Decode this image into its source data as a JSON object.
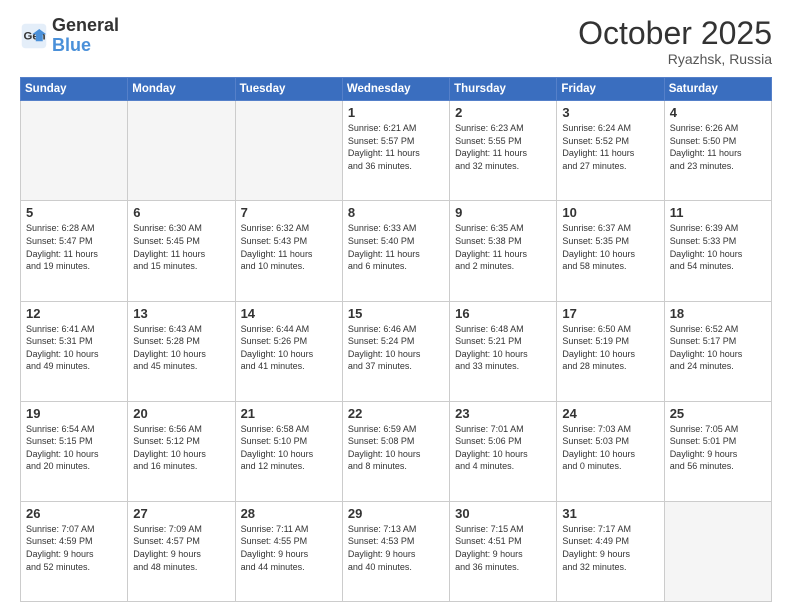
{
  "header": {
    "logo_line1": "General",
    "logo_line2": "Blue",
    "month": "October 2025",
    "location": "Ryazhsk, Russia"
  },
  "weekdays": [
    "Sunday",
    "Monday",
    "Tuesday",
    "Wednesday",
    "Thursday",
    "Friday",
    "Saturday"
  ],
  "weeks": [
    [
      {
        "day": "",
        "info": ""
      },
      {
        "day": "",
        "info": ""
      },
      {
        "day": "",
        "info": ""
      },
      {
        "day": "1",
        "info": "Sunrise: 6:21 AM\nSunset: 5:57 PM\nDaylight: 11 hours\nand 36 minutes."
      },
      {
        "day": "2",
        "info": "Sunrise: 6:23 AM\nSunset: 5:55 PM\nDaylight: 11 hours\nand 32 minutes."
      },
      {
        "day": "3",
        "info": "Sunrise: 6:24 AM\nSunset: 5:52 PM\nDaylight: 11 hours\nand 27 minutes."
      },
      {
        "day": "4",
        "info": "Sunrise: 6:26 AM\nSunset: 5:50 PM\nDaylight: 11 hours\nand 23 minutes."
      }
    ],
    [
      {
        "day": "5",
        "info": "Sunrise: 6:28 AM\nSunset: 5:47 PM\nDaylight: 11 hours\nand 19 minutes."
      },
      {
        "day": "6",
        "info": "Sunrise: 6:30 AM\nSunset: 5:45 PM\nDaylight: 11 hours\nand 15 minutes."
      },
      {
        "day": "7",
        "info": "Sunrise: 6:32 AM\nSunset: 5:43 PM\nDaylight: 11 hours\nand 10 minutes."
      },
      {
        "day": "8",
        "info": "Sunrise: 6:33 AM\nSunset: 5:40 PM\nDaylight: 11 hours\nand 6 minutes."
      },
      {
        "day": "9",
        "info": "Sunrise: 6:35 AM\nSunset: 5:38 PM\nDaylight: 11 hours\nand 2 minutes."
      },
      {
        "day": "10",
        "info": "Sunrise: 6:37 AM\nSunset: 5:35 PM\nDaylight: 10 hours\nand 58 minutes."
      },
      {
        "day": "11",
        "info": "Sunrise: 6:39 AM\nSunset: 5:33 PM\nDaylight: 10 hours\nand 54 minutes."
      }
    ],
    [
      {
        "day": "12",
        "info": "Sunrise: 6:41 AM\nSunset: 5:31 PM\nDaylight: 10 hours\nand 49 minutes."
      },
      {
        "day": "13",
        "info": "Sunrise: 6:43 AM\nSunset: 5:28 PM\nDaylight: 10 hours\nand 45 minutes."
      },
      {
        "day": "14",
        "info": "Sunrise: 6:44 AM\nSunset: 5:26 PM\nDaylight: 10 hours\nand 41 minutes."
      },
      {
        "day": "15",
        "info": "Sunrise: 6:46 AM\nSunset: 5:24 PM\nDaylight: 10 hours\nand 37 minutes."
      },
      {
        "day": "16",
        "info": "Sunrise: 6:48 AM\nSunset: 5:21 PM\nDaylight: 10 hours\nand 33 minutes."
      },
      {
        "day": "17",
        "info": "Sunrise: 6:50 AM\nSunset: 5:19 PM\nDaylight: 10 hours\nand 28 minutes."
      },
      {
        "day": "18",
        "info": "Sunrise: 6:52 AM\nSunset: 5:17 PM\nDaylight: 10 hours\nand 24 minutes."
      }
    ],
    [
      {
        "day": "19",
        "info": "Sunrise: 6:54 AM\nSunset: 5:15 PM\nDaylight: 10 hours\nand 20 minutes."
      },
      {
        "day": "20",
        "info": "Sunrise: 6:56 AM\nSunset: 5:12 PM\nDaylight: 10 hours\nand 16 minutes."
      },
      {
        "day": "21",
        "info": "Sunrise: 6:58 AM\nSunset: 5:10 PM\nDaylight: 10 hours\nand 12 minutes."
      },
      {
        "day": "22",
        "info": "Sunrise: 6:59 AM\nSunset: 5:08 PM\nDaylight: 10 hours\nand 8 minutes."
      },
      {
        "day": "23",
        "info": "Sunrise: 7:01 AM\nSunset: 5:06 PM\nDaylight: 10 hours\nand 4 minutes."
      },
      {
        "day": "24",
        "info": "Sunrise: 7:03 AM\nSunset: 5:03 PM\nDaylight: 10 hours\nand 0 minutes."
      },
      {
        "day": "25",
        "info": "Sunrise: 7:05 AM\nSunset: 5:01 PM\nDaylight: 9 hours\nand 56 minutes."
      }
    ],
    [
      {
        "day": "26",
        "info": "Sunrise: 7:07 AM\nSunset: 4:59 PM\nDaylight: 9 hours\nand 52 minutes."
      },
      {
        "day": "27",
        "info": "Sunrise: 7:09 AM\nSunset: 4:57 PM\nDaylight: 9 hours\nand 48 minutes."
      },
      {
        "day": "28",
        "info": "Sunrise: 7:11 AM\nSunset: 4:55 PM\nDaylight: 9 hours\nand 44 minutes."
      },
      {
        "day": "29",
        "info": "Sunrise: 7:13 AM\nSunset: 4:53 PM\nDaylight: 9 hours\nand 40 minutes."
      },
      {
        "day": "30",
        "info": "Sunrise: 7:15 AM\nSunset: 4:51 PM\nDaylight: 9 hours\nand 36 minutes."
      },
      {
        "day": "31",
        "info": "Sunrise: 7:17 AM\nSunset: 4:49 PM\nDaylight: 9 hours\nand 32 minutes."
      },
      {
        "day": "",
        "info": ""
      }
    ]
  ]
}
